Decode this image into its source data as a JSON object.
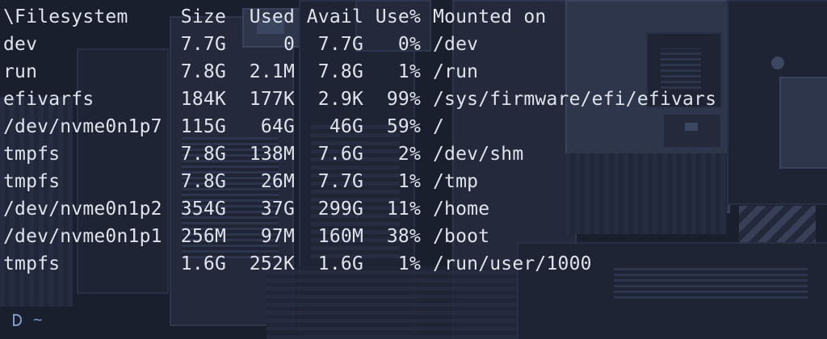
{
  "terminal": {
    "header": {
      "filesystem": "\\Filesystem",
      "size": "Size",
      "used": "Used",
      "avail": "Avail",
      "use_pct": "Use%",
      "mounted_on": "Mounted on"
    },
    "rows": [
      {
        "filesystem": "dev",
        "size": "7.7G",
        "used": "0",
        "avail": "7.7G",
        "use_pct": "0%",
        "mounted_on": "/dev"
      },
      {
        "filesystem": "run",
        "size": "7.8G",
        "used": "2.1M",
        "avail": "7.8G",
        "use_pct": "1%",
        "mounted_on": "/run"
      },
      {
        "filesystem": "efivarfs",
        "size": "184K",
        "used": "177K",
        "avail": "2.9K",
        "use_pct": "99%",
        "mounted_on": "/sys/firmware/efi/efivars"
      },
      {
        "filesystem": "/dev/nvme0n1p7",
        "size": "115G",
        "used": "64G",
        "avail": "46G",
        "use_pct": "59%",
        "mounted_on": "/"
      },
      {
        "filesystem": "tmpfs",
        "size": "7.8G",
        "used": "138M",
        "avail": "7.6G",
        "use_pct": "2%",
        "mounted_on": "/dev/shm"
      },
      {
        "filesystem": "tmpfs",
        "size": "7.8G",
        "used": "26M",
        "avail": "7.7G",
        "use_pct": "1%",
        "mounted_on": "/tmp"
      },
      {
        "filesystem": "/dev/nvme0n1p2",
        "size": "354G",
        "used": "37G",
        "avail": "299G",
        "use_pct": "11%",
        "mounted_on": "/home"
      },
      {
        "filesystem": "/dev/nvme0n1p1",
        "size": "256M",
        "used": "97M",
        "avail": "160M",
        "use_pct": "38%",
        "mounted_on": "/boot"
      },
      {
        "filesystem": "tmpfs",
        "size": "1.6G",
        "used": "252K",
        "avail": "1.6G",
        "use_pct": "1%",
        "mounted_on": "/run/user/1000"
      }
    ],
    "prompt": {
      "icon": "prompt-cursor-icon",
      "path": "~"
    },
    "colors": {
      "text": "#dfe3ec",
      "prompt": "#7f9ac4",
      "background": "#1d2332"
    }
  }
}
